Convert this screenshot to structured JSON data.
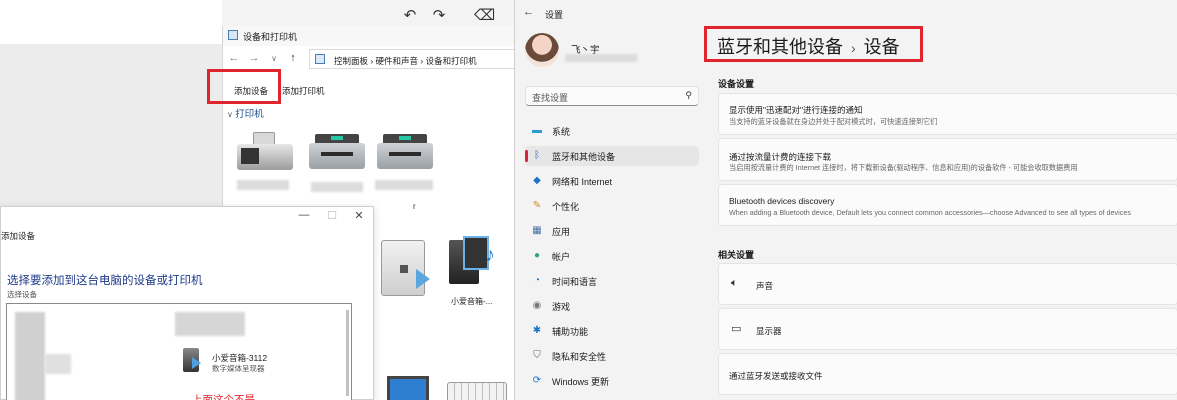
{
  "cp": {
    "title": "设备和打印机",
    "breadcrumb": "控制面板  ›  硬件和声音  ›  设备和打印机",
    "add_device": "添加设备",
    "add_printer": "添加打印机",
    "printers_header": "打印机",
    "device_label_r": "r",
    "device_label_speaker": "小爱音箱-..."
  },
  "dialog": {
    "title": "添加设备",
    "heading": "选择要添加到这台电脑的设备或打印机",
    "subheading": "选择设备",
    "device_name": "小爱音箱-3112",
    "device_type": "数字媒体呈现器",
    "note": "上面这个不是"
  },
  "settings": {
    "window_title": "设置",
    "username": "飞丶宇",
    "search_placeholder": "查找设置",
    "nav": [
      {
        "label": "系统",
        "icon": "monitor-icon",
        "selected": false
      },
      {
        "label": "蓝牙和其他设备",
        "icon": "bluetooth-icon",
        "selected": true
      },
      {
        "label": "网络和 Internet",
        "icon": "wifi-icon",
        "selected": false
      },
      {
        "label": "个性化",
        "icon": "brush-icon",
        "selected": false
      },
      {
        "label": "应用",
        "icon": "apps-icon",
        "selected": false
      },
      {
        "label": "帐户",
        "icon": "person-icon",
        "selected": false
      },
      {
        "label": "时间和语言",
        "icon": "globe-clock-icon",
        "selected": false
      },
      {
        "label": "游戏",
        "icon": "gamepad-icon",
        "selected": false
      },
      {
        "label": "辅助功能",
        "icon": "accessibility-icon",
        "selected": false
      },
      {
        "label": "隐私和安全性",
        "icon": "shield-icon",
        "selected": false
      },
      {
        "label": "Windows 更新",
        "icon": "update-icon",
        "selected": false
      }
    ],
    "breadcrumb_parent": "蓝牙和其他设备",
    "breadcrumb_separator": "›",
    "breadcrumb_current": "设备",
    "section_device_settings": "设备设置",
    "cards": [
      {
        "title": "显示使用\"迅速配对\"进行连接的通知",
        "desc": "当支持的蓝牙设备就在身边并处于配对模式时，可快速连接到它们"
      },
      {
        "title": "通过按流量计费的连接下载",
        "desc": "当启用按流量计费的 Internet 连接时，将下载新设备(驱动程序、信息和应用)的设备软件 - 可能会收取数据费用"
      },
      {
        "title": "Bluetooth devices discovery",
        "desc": "When adding a Bluetooth device, Default lets you connect common accessories—choose Advanced to see all types of devices"
      }
    ],
    "section_related": "相关设置",
    "related": [
      {
        "label": "声音",
        "icon": "speaker-icon"
      },
      {
        "label": "显示器",
        "icon": "display-icon"
      },
      {
        "label": "通过蓝牙发送或接收文件",
        "icon": ""
      }
    ]
  },
  "colors": {
    "highlight_red": "#e0262c",
    "accent_blue": "#0067c0",
    "selected_indicator": "#d6263a"
  }
}
